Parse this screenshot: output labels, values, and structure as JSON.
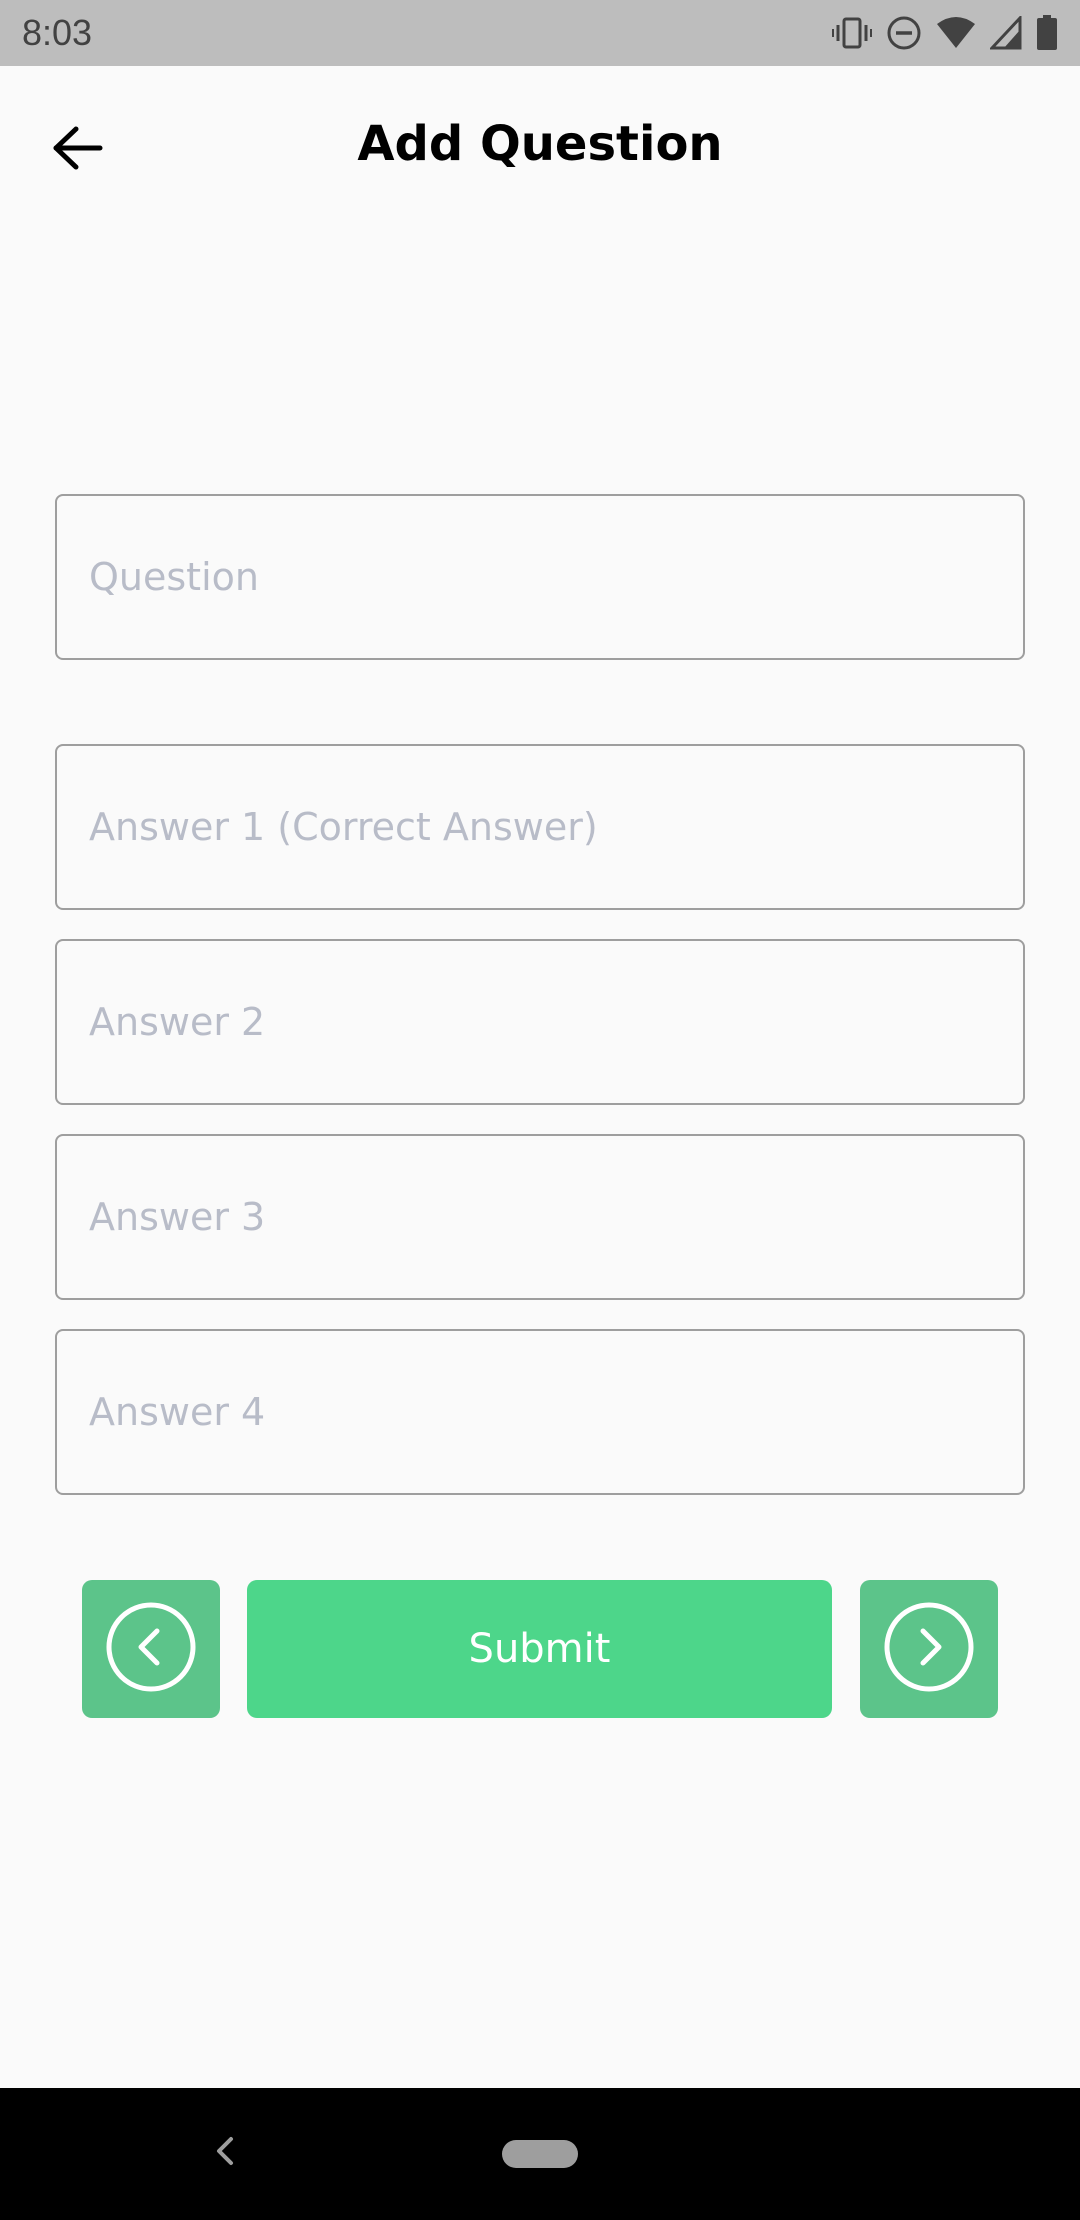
{
  "status_bar": {
    "time": "8:03",
    "icons": [
      "vibrate-icon",
      "do-not-disturb-icon",
      "wifi-icon",
      "signal-icon",
      "battery-icon"
    ]
  },
  "app_bar": {
    "title": "Add Question",
    "back_icon": "arrow-left-icon"
  },
  "form": {
    "question_placeholder": "Question",
    "answer1_placeholder": "Answer 1 (Correct Answer)",
    "answer2_placeholder": "Answer 2",
    "answer3_placeholder": "Answer 3",
    "answer4_placeholder": "Answer 4"
  },
  "actions": {
    "prev_icon": "chevron-left-circle-icon",
    "submit_label": "Submit",
    "next_icon": "chevron-right-circle-icon"
  },
  "colors": {
    "accent": "#4dd68a",
    "nav_button": "#5cc48a",
    "status_bar": "#bdbdbd",
    "background": "#fafafa"
  }
}
